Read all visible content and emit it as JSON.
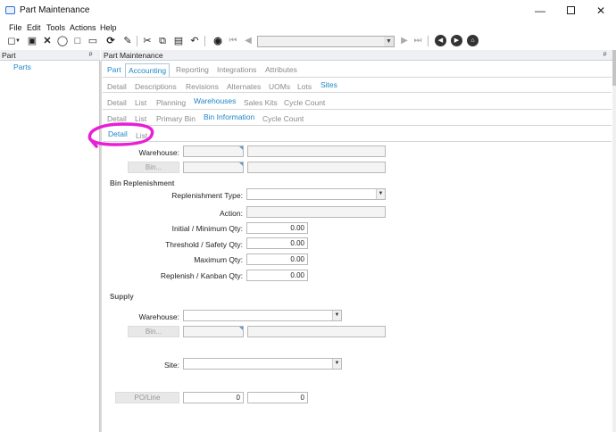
{
  "window": {
    "title": "Part Maintenance",
    "minimize": "—",
    "close": "✕"
  },
  "menu": [
    "File",
    "Edit",
    "Tools",
    "Actions",
    "Help"
  ],
  "left_panel": {
    "title": "Part",
    "pin": "ᵖ",
    "tree": [
      "Parts"
    ]
  },
  "right_panel": {
    "title": "Part Maintenance",
    "pin": "ᵖ"
  },
  "tabs": {
    "row1": [
      "Part",
      "Accounting",
      "Reporting",
      "Integrations",
      "Attributes"
    ],
    "row2": [
      "Detail",
      "Descriptions",
      "Revisions",
      "Alternates",
      "UOMs",
      "Lots",
      "Sites"
    ],
    "row3": [
      "Detail",
      "List",
      "Planning",
      "Warehouses",
      "Sales Kits",
      "Cycle Count"
    ],
    "row4": [
      "Detail",
      "List",
      "Primary Bin",
      "Bin Information",
      "Cycle Count"
    ],
    "row5": [
      "Detail",
      "List"
    ]
  },
  "form": {
    "warehouse_label": "Warehouse:",
    "bin_button": "Bin...",
    "bin_replenishment_section": "Bin Replenishment",
    "replenishment_type_label": "Replenishment Type:",
    "action_label": "Action:",
    "initial_min_label": "Initial / Minimum Qty:",
    "initial_min_value": "0.00",
    "threshold_label": "Threshold / Safety Qty:",
    "threshold_value": "0.00",
    "maximum_label": "Maximum Qty:",
    "maximum_value": "0.00",
    "replenish_kanban_label": "Replenish / Kanban Qty:",
    "replenish_kanban_value": "0.00",
    "supply_section": "Supply",
    "supply_warehouse_label": "Warehouse:",
    "supply_bin_button": "Bin...",
    "site_label": "Site:",
    "po_line_button": "PO/Line",
    "po_value": "0",
    "line_value": "0"
  },
  "colors": {
    "accent": "#1f86c7",
    "annotation": "#e81fd6"
  }
}
